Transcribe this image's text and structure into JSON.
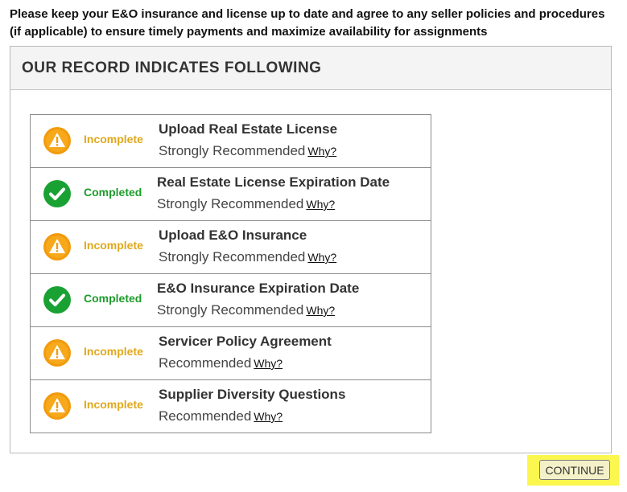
{
  "intro_text": "Please keep your E&O insurance and license up to date and agree to any seller policies and procedures (if applicable) to ensure timely payments and maximize availability for assignments",
  "panel": {
    "title": "OUR RECORD INDICATES FOLLOWING"
  },
  "items": [
    {
      "status": "Incomplete",
      "title": "Upload Real Estate License",
      "recommendation": "Strongly Recommended",
      "why": "Why?"
    },
    {
      "status": "Completed",
      "title": "Real Estate License Expiration Date",
      "recommendation": "Strongly Recommended",
      "why": "Why?"
    },
    {
      "status": "Incomplete",
      "title": "Upload E&O Insurance",
      "recommendation": "Strongly Recommended",
      "why": "Why?"
    },
    {
      "status": "Completed",
      "title": "E&O Insurance Expiration Date",
      "recommendation": "Strongly Recommended",
      "why": "Why?"
    },
    {
      "status": "Incomplete",
      "title": "Servicer Policy Agreement",
      "recommendation": "Recommended",
      "why": "Why?"
    },
    {
      "status": "Incomplete",
      "title": "Supplier Diversity Questions",
      "recommendation": "Recommended",
      "why": "Why?"
    }
  ],
  "icons": {
    "incomplete": "warning-icon",
    "completed": "check-circle-icon"
  },
  "colors": {
    "incomplete": "#e0a81c",
    "completed": "#1e9b2b",
    "highlight": "#fbf74f"
  },
  "continue_label": "CONTINUE"
}
